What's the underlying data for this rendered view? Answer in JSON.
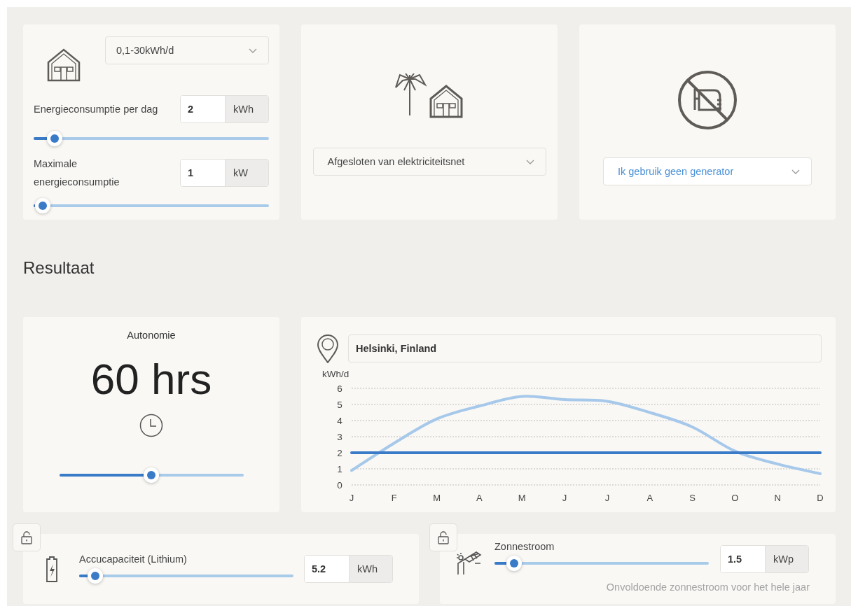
{
  "energy_card": {
    "range_dropdown": {
      "value": "0,1-30kWh/d",
      "kind": "plain"
    },
    "fields": [
      {
        "label": "Energieconsumptie per dag",
        "value": "2",
        "unit": "kWh",
        "level": 0.09
      },
      {
        "label": "Maximale energieconsumptie",
        "value": "1",
        "unit": "kW",
        "level": 0.04
      }
    ]
  },
  "grid_card": {
    "dropdown": {
      "value": "Afgesloten van elektriciteitsnet",
      "kind": "plain"
    }
  },
  "generator_card": {
    "dropdown": {
      "value": "Ik gebruik geen generator",
      "kind": "accent"
    }
  },
  "result_heading": "Resultaat",
  "autonomy": {
    "title": "Autonomie",
    "value": "60 hrs",
    "level": 0.5
  },
  "location": {
    "value": "Helsinki, Finland",
    "chart_data": {
      "type": "line",
      "ylabel": "kWh/d",
      "categories": [
        "J",
        "F",
        "M",
        "A",
        "M",
        "J",
        "J",
        "A",
        "S",
        "O",
        "N",
        "D"
      ],
      "ylim": [
        0,
        6
      ],
      "grid": true,
      "yticks": [
        0,
        1,
        2,
        3,
        4,
        5,
        6
      ],
      "series": [
        {
          "color": "#a6c8ea",
          "values": [
            0.9,
            2.6,
            4.1,
            4.9,
            5.5,
            5.3,
            5.2,
            4.5,
            3.6,
            2.1,
            1.3,
            0.7
          ]
        },
        {
          "color": "#3a7bc8",
          "values": [
            2,
            2,
            2,
            2,
            2,
            2,
            2,
            2,
            2,
            2,
            2,
            2
          ]
        }
      ]
    }
  },
  "battery": {
    "locked": false,
    "label": "Accucapaciteit (Lithium)",
    "value": "5.2",
    "unit": "kWh",
    "level": 0.075
  },
  "solar": {
    "locked": false,
    "label": "Zonnestroom",
    "value": "1.5",
    "unit": "kWp",
    "level": 0.09,
    "note": "Onvoldoende zonnestroom voor het hele jaar"
  }
}
